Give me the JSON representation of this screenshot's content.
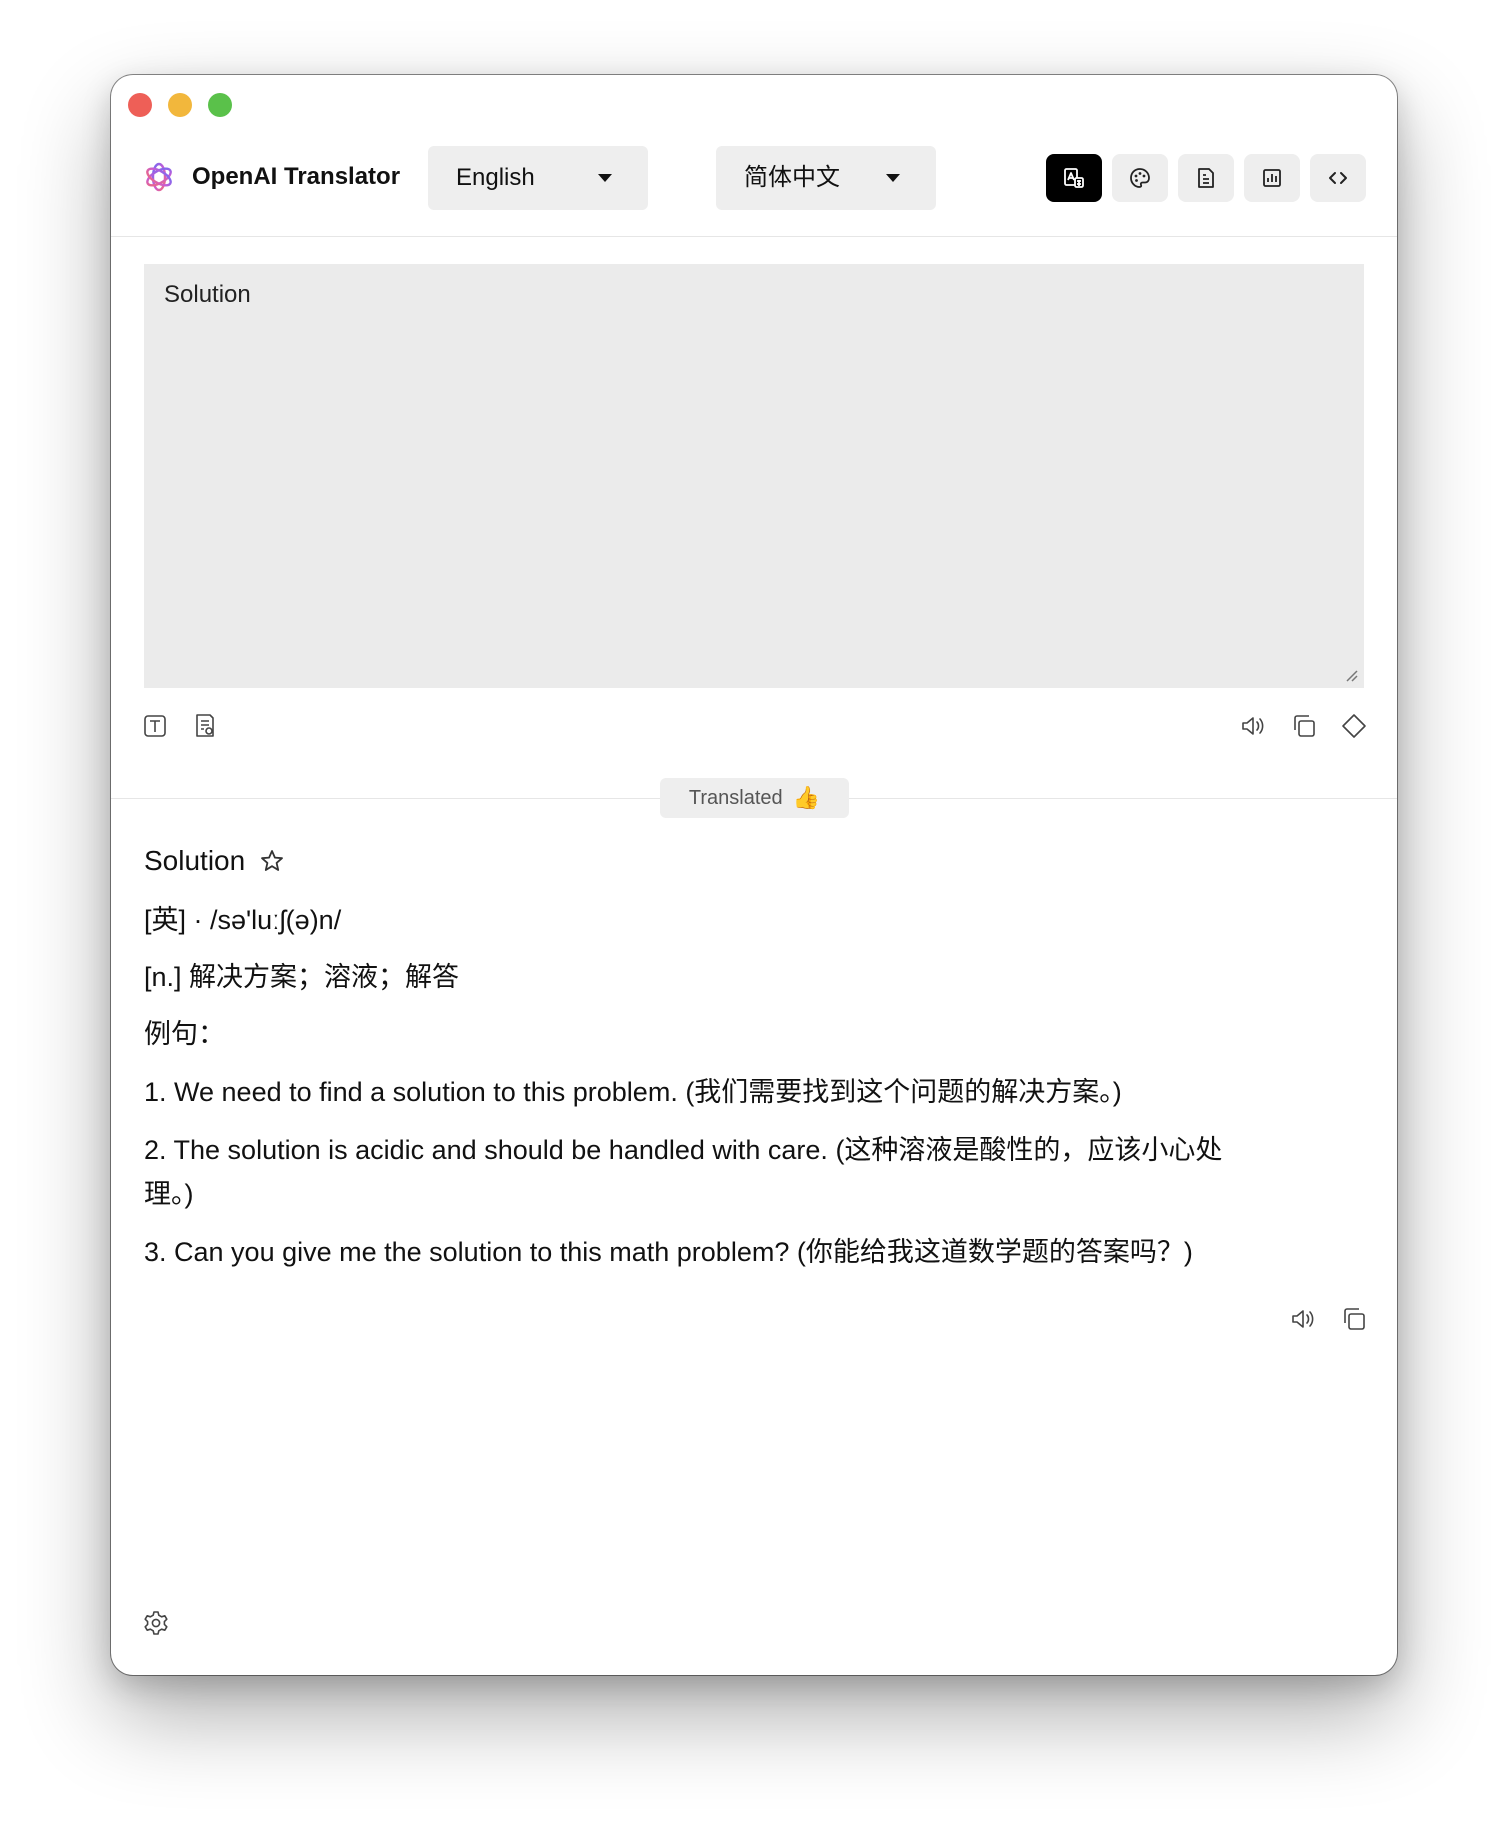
{
  "window": {
    "controls": [
      "close",
      "minimize",
      "zoom"
    ]
  },
  "header": {
    "app_title": "OpenAI Translator",
    "source_language": "English",
    "target_language": "简体中文",
    "toolbar_icons": [
      "translate-mode-icon",
      "theme-palette-icon",
      "document-icon",
      "chart-icon",
      "code-icon"
    ]
  },
  "source": {
    "text": "Solution"
  },
  "badge": {
    "label": "Translated",
    "emoji": "👍"
  },
  "result": {
    "word": "Solution",
    "phonetic": "[英] · /sə'luːʃ(ə)n/",
    "definition": "[n.] 解决方案；溶液；解答",
    "examples_label": "例句：",
    "example_1": "1. We need to find a solution to this problem. (我们需要找到这个问题的解决方案。)",
    "example_2_line1": "2. The solution is acidic and should be handled with care. (这种溶液是酸性的，应该小心处",
    "example_2_line2": "理。)",
    "example_3": "3. Can you give me the solution to this math problem? (你能给我这道数学题的答案吗？)"
  }
}
